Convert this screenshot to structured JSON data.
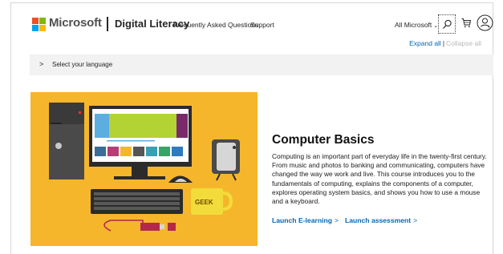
{
  "header": {
    "brand": "Microsoft",
    "site_title": "Digital Literacy",
    "nav": [
      "Frequently Asked Questions",
      "Support"
    ],
    "all_microsoft": "All Microsoft",
    "icons": [
      "search-icon",
      "cart-icon",
      "user-icon"
    ]
  },
  "controls": {
    "expand_all": "Expand all",
    "separator": "|",
    "collapse_all": "Collapse all"
  },
  "language_bar": {
    "label": "Select your language"
  },
  "course": {
    "title": "Computer Basics",
    "description": "Computing is an important part of everyday life in the twenty-first century. From music and photos to banking and communicating, computers have changed the way we work and live. This course introduces you to the fundamentals of computing, explains the components of a computer, explores operating system basics, and shows you how to use a mouse and a keyboard.",
    "links": [
      {
        "label": "Launch E-learning"
      },
      {
        "label": "Launch assessment"
      }
    ],
    "image_text": "GEEK"
  },
  "colors": {
    "accent": "#0067b8",
    "hero_background": "#f6b62c",
    "bar_background": "#f2f2f2"
  }
}
